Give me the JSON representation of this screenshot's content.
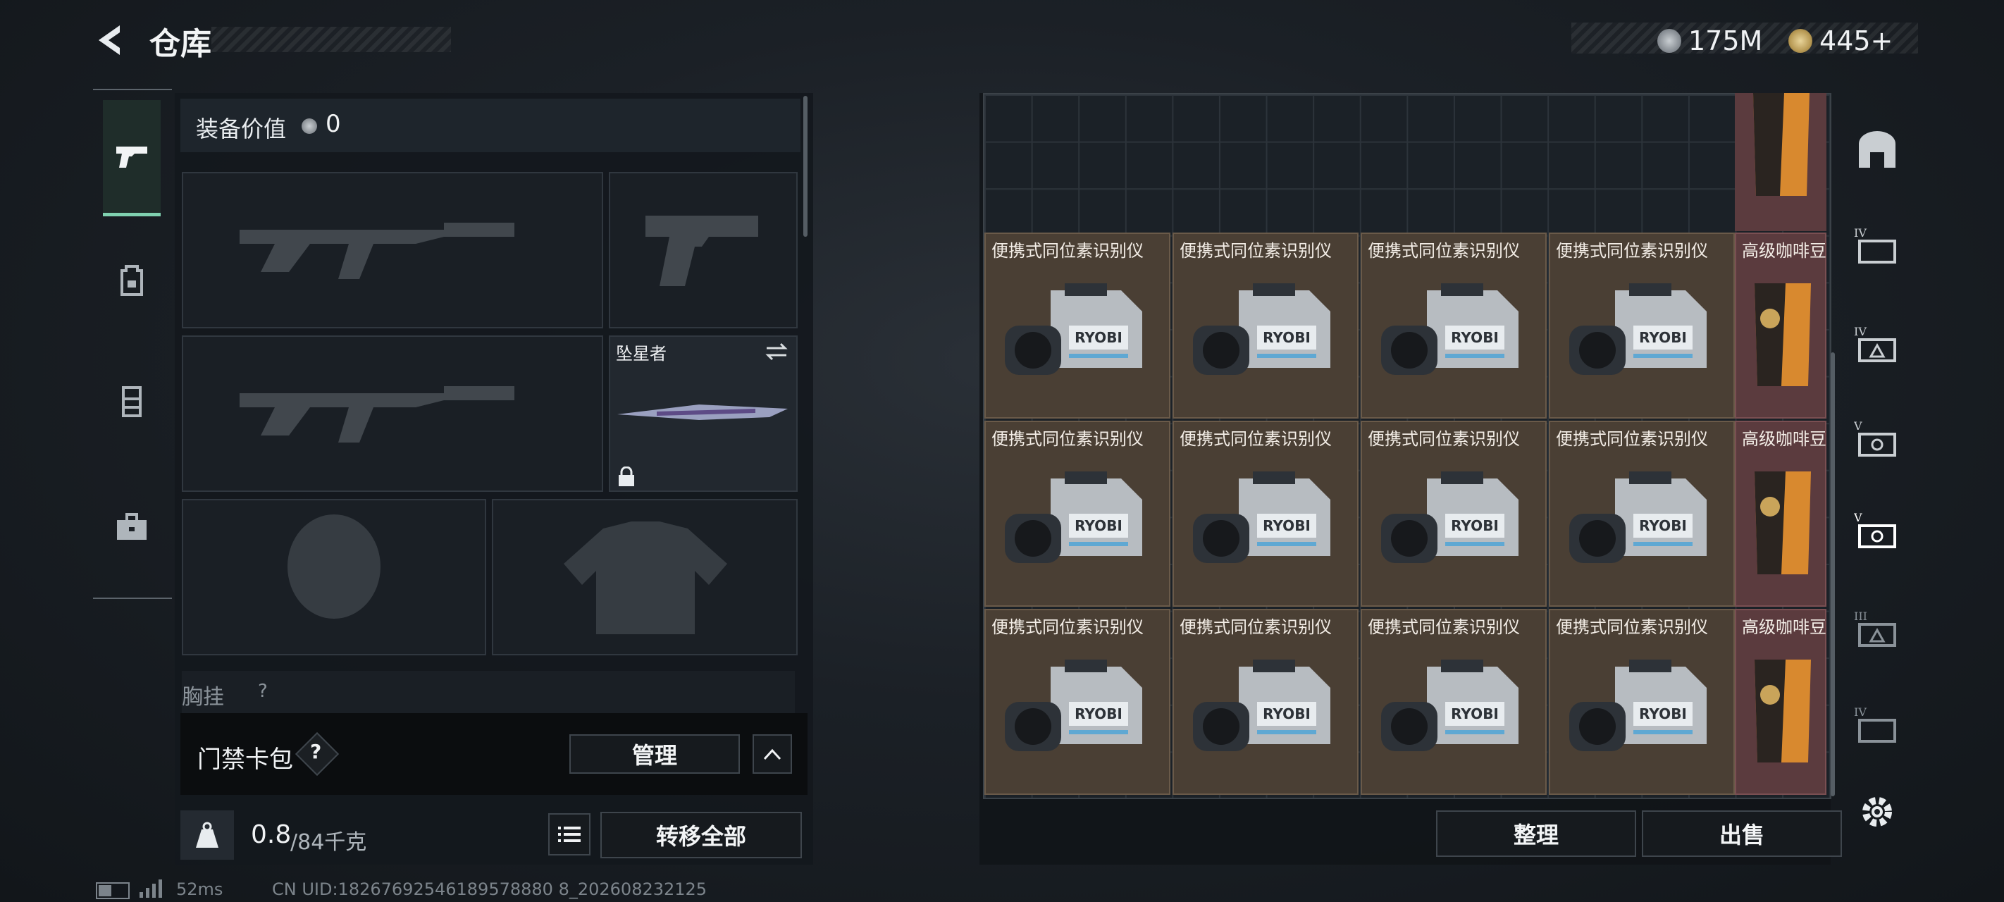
{
  "header": {
    "title": "仓库",
    "currency_1": "175M",
    "currency_2": "445+"
  },
  "left_nav": {
    "items": [
      {
        "icon": "pistol-icon",
        "active": true
      },
      {
        "icon": "backpack-icon",
        "active": false
      },
      {
        "icon": "vest-icon",
        "active": false
      },
      {
        "icon": "toolbox-icon",
        "active": false
      }
    ]
  },
  "equipment": {
    "value_label": "装备价值",
    "value": "0",
    "melee_name": "坠星者",
    "next_section_label": "胸挂",
    "next_section_count": "?"
  },
  "access_card": {
    "label": "门禁卡包",
    "help": "?",
    "manage_label": "管理"
  },
  "weight": {
    "current": "0.8",
    "max": "/84千克",
    "icon_label": "KG"
  },
  "transfer_all_label": "转移全部",
  "inventory": {
    "item_a": "便携式同位素识别仪",
    "item_b": "高级咖啡豆",
    "item_b_top": "高级咖啡豆",
    "rows": [
      [
        "便携式同位素识别仪",
        "便携式同位素识别仪",
        "便携式同位素识别仪",
        "便携式同位素识别仪",
        "高级咖啡豆"
      ],
      [
        "便携式同位素识别仪",
        "便携式同位素识别仪",
        "便携式同位素识别仪",
        "便携式同位素识别仪",
        "高级咖啡豆"
      ],
      [
        "便携式同位素识别仪",
        "便携式同位素识别仪",
        "便携式同位素识别仪",
        "便携式同位素识别仪",
        "高级咖啡豆"
      ]
    ],
    "device_brand": "RYOBI"
  },
  "actions": {
    "sort_label": "整理",
    "sell_label": "出售"
  },
  "right_nav": {
    "items": [
      {
        "icon": "safe-box-icon"
      },
      {
        "icon": "level-iv-case-icon",
        "level": "IV"
      },
      {
        "icon": "level-iv-case-icon",
        "level": "IV"
      },
      {
        "icon": "level-v-case-icon",
        "level": "V"
      },
      {
        "icon": "level-v-case-icon",
        "level": "V"
      },
      {
        "icon": "level-iii-case-icon",
        "level": "III"
      },
      {
        "icon": "level-iv-case-icon",
        "level": "IV"
      },
      {
        "icon": "settings-icon"
      }
    ]
  },
  "status_bar": {
    "ping": "52ms",
    "uid": "CN UID:18267692546189578880 8_202608232125"
  },
  "colors": {
    "accent": "#7fd1b0",
    "item_bg": "#4a3f34",
    "coffee_bg": "#5b3b3e"
  }
}
